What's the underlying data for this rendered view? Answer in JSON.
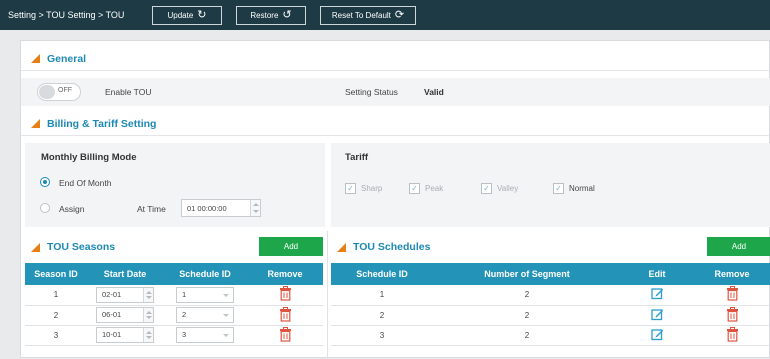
{
  "topbar": {
    "breadcrumb": "Setting > TOU Setting > TOU",
    "buttons": [
      {
        "label": "Update",
        "icon": "refresh-icon"
      },
      {
        "label": "Restore",
        "icon": "history-icon"
      },
      {
        "label": "Reset To Default",
        "icon": "sync-icon"
      }
    ]
  },
  "general": {
    "title": "General",
    "toggle_label": "OFF",
    "enable_label": "Enable TOU",
    "status_label": "Setting Status",
    "status_value": "Valid"
  },
  "billing": {
    "title": "Billing & Tariff Setting",
    "mode_title": "Monthly Billing Mode",
    "option_end": "End Of Month",
    "option_assign": "Assign",
    "at_time_label": "At Time",
    "at_time_value": "01 00:00:00",
    "tariff_title": "Tariff",
    "tariffs": [
      {
        "label": "Sharp",
        "checked": true
      },
      {
        "label": "Peak",
        "checked": true
      },
      {
        "label": "Valley",
        "checked": true
      },
      {
        "label": "Normal",
        "checked": true
      }
    ]
  },
  "seasons": {
    "title": "TOU Seasons",
    "add_label": "Add",
    "columns": [
      "Season ID",
      "Start Date",
      "Schedule ID",
      "Remove"
    ],
    "rows": [
      {
        "id": "1",
        "start": "02-01",
        "schedule": "1"
      },
      {
        "id": "2",
        "start": "06-01",
        "schedule": "2"
      },
      {
        "id": "3",
        "start": "10-01",
        "schedule": "3"
      }
    ]
  },
  "schedules": {
    "title": "TOU Schedules",
    "add_label": "Add",
    "columns": [
      "Schedule ID",
      "Number of Segment",
      "Edit",
      "Remove"
    ],
    "rows": [
      {
        "id": "1",
        "segments": "2"
      },
      {
        "id": "2",
        "segments": "2"
      },
      {
        "id": "3",
        "segments": "2"
      }
    ]
  },
  "colors": {
    "topbar": "#1e3a45",
    "accent": "#1d89b3",
    "table_header": "#2393b8",
    "add_button": "#1ea64b",
    "remove_icon": "#e0533f",
    "section_marker": "#e57f16"
  }
}
